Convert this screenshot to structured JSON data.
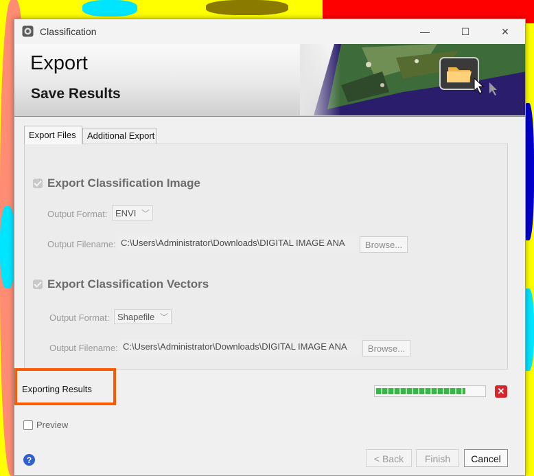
{
  "window": {
    "title": "Classification",
    "controls": {
      "minimize": "—",
      "maximize": "☐",
      "close": "✕"
    }
  },
  "banner": {
    "title": "Export",
    "subtitle": "Save Results"
  },
  "tabs": [
    {
      "label": "Export Files",
      "active": true
    },
    {
      "label": "Additional Export",
      "active": false
    }
  ],
  "export_image": {
    "heading": "Export Classification Image",
    "checked": true,
    "format_label": "Output Format:",
    "format_value": "ENVI",
    "filename_label": "Output Filename:",
    "filename_value": "C:\\Users\\Administrator\\Downloads\\DIGITAL IMAGE ANA",
    "browse_label": "Browse..."
  },
  "export_vectors": {
    "heading": "Export Classification Vectors",
    "checked": true,
    "format_label": "Output Format:",
    "format_value": "Shapefile",
    "filename_label": "Output Filename:",
    "filename_value": "C:\\Users\\Administrator\\Downloads\\DIGITAL IMAGE ANA",
    "browse_label": "Browse..."
  },
  "status": {
    "text": "Exporting Results",
    "progress_fraction": 0.83,
    "highlight_color": "#ff5a00"
  },
  "preview": {
    "label": "Preview",
    "checked": false
  },
  "footer": {
    "help_icon": "?",
    "back_label": "< Back",
    "finish_label": "Finish",
    "cancel_label": "Cancel"
  }
}
